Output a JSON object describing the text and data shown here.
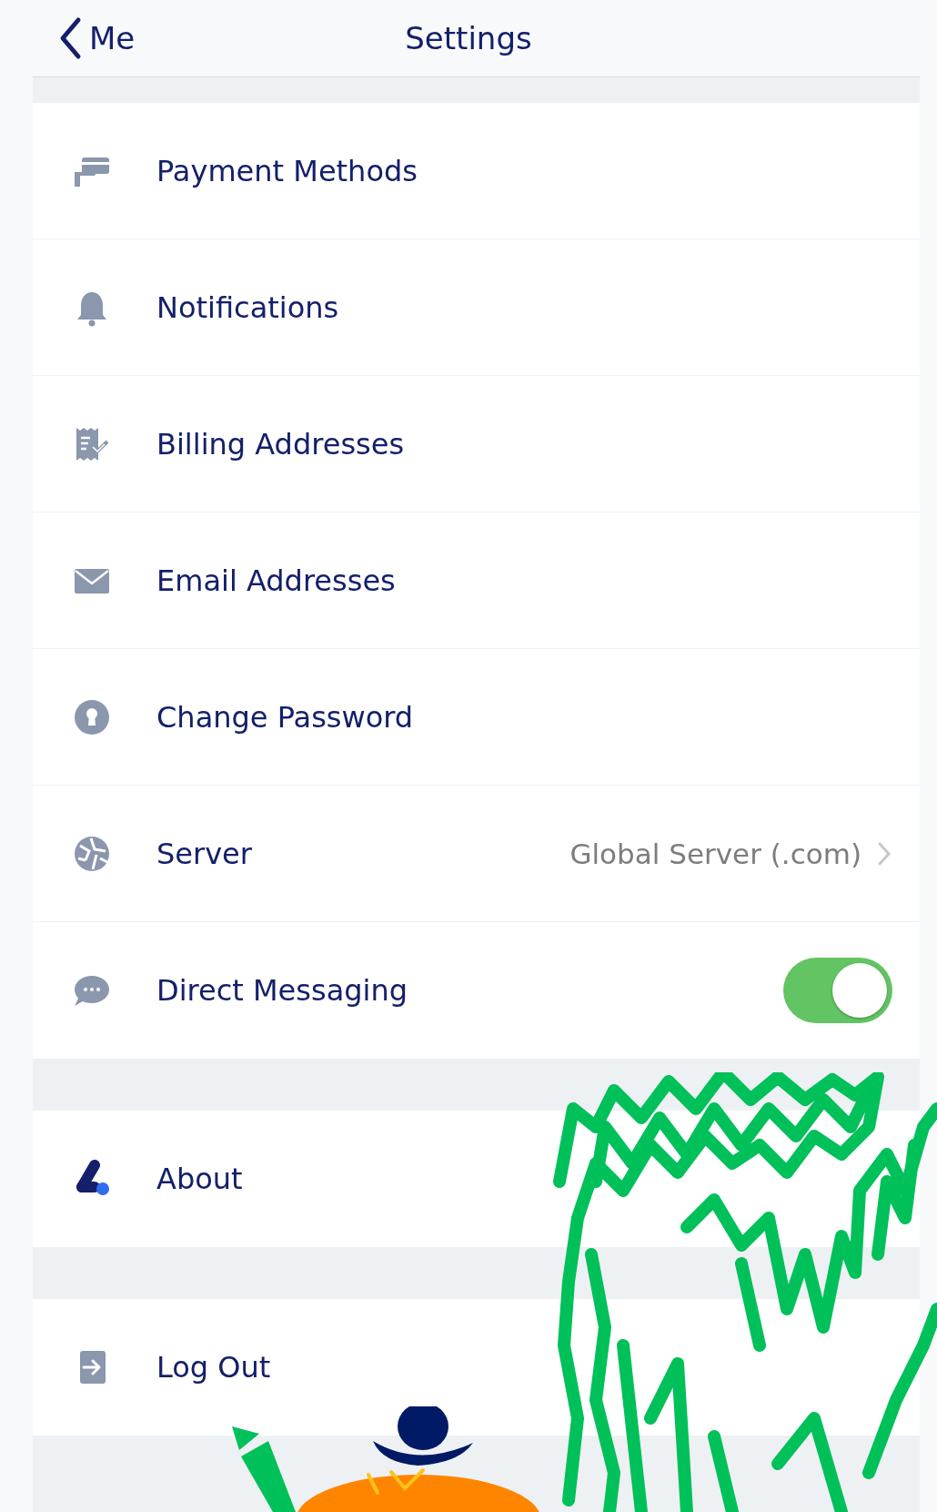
{
  "nav": {
    "back_label": "Me",
    "title": "Settings"
  },
  "groups": [
    {
      "items": [
        {
          "kind": "link",
          "label": "Payment Methods"
        },
        {
          "kind": "link",
          "label": "Notifications"
        },
        {
          "kind": "link",
          "label": "Billing Addresses"
        },
        {
          "kind": "link",
          "label": "Email Addresses"
        },
        {
          "kind": "link",
          "label": "Change Password"
        },
        {
          "kind": "value",
          "label": "Server",
          "value": "Global Server (.com)"
        },
        {
          "kind": "toggle",
          "label": "Direct Messaging",
          "on": true
        }
      ]
    },
    {
      "items": [
        {
          "kind": "link",
          "label": "About"
        }
      ]
    },
    {
      "items": [
        {
          "kind": "link",
          "label": "Log Out"
        }
      ]
    }
  ]
}
